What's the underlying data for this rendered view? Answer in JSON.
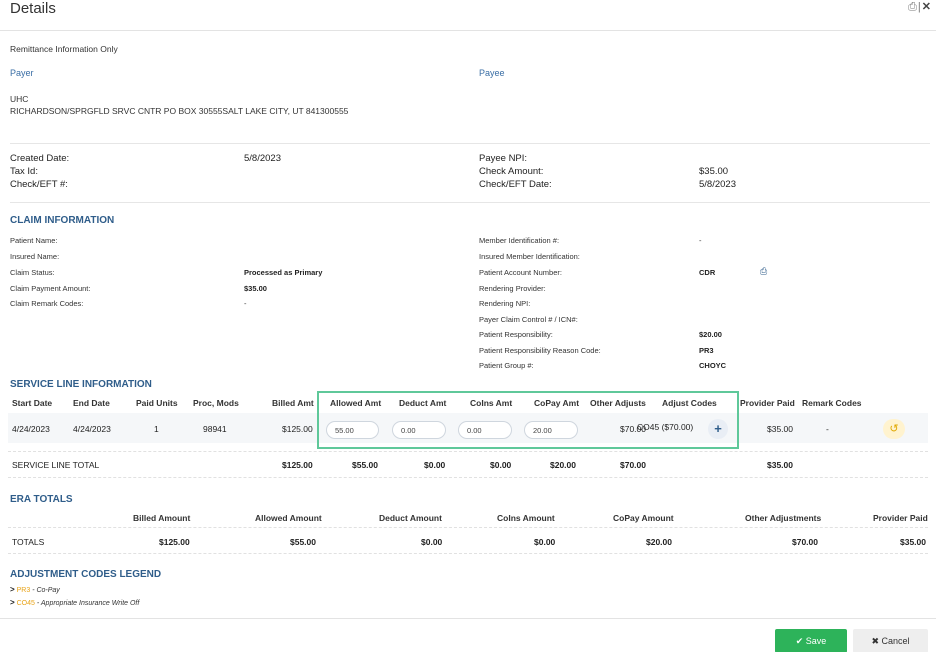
{
  "header": {
    "title": "Details",
    "window_icons": "⎙ | ✕"
  },
  "remittance_note": "Remittance Information Only",
  "payer": {
    "label": "Payer",
    "name": "UHC",
    "address": "RICHARDSON/SPRGFLD SRVC CNTR PO BOX 30555SALT LAKE CITY, UT 841300555"
  },
  "payee": {
    "label": "Payee"
  },
  "summary": {
    "created_date_label": "Created Date:",
    "created_date": "5/8/2023",
    "tax_id_label": "Tax Id:",
    "check_label": "Check/EFT #:",
    "payee_npi_label": "Payee NPI:",
    "check_amount_label": "Check Amount:",
    "check_amount": "$35.00",
    "check_date_label": "Check/EFT Date:",
    "check_date": "5/8/2023"
  },
  "claim": {
    "title": "CLAIM INFORMATION",
    "patient_name_label": "Patient Name:",
    "insured_name_label": "Insured Name:",
    "claim_status_label": "Claim Status:",
    "claim_status": "Processed as Primary",
    "payment_amount_label": "Claim Payment Amount:",
    "payment_amount": "$35.00",
    "remark_codes_label": "Claim Remark Codes:",
    "remark_codes": "-",
    "member_id_label": "Member Identification #:",
    "member_id": "-",
    "insured_member_id_label": "Insured Member Identification:",
    "patient_account_label": "Patient Account Number:",
    "patient_account": "CDR",
    "rendering_provider_label": "Rendering Provider:",
    "rendering_npi_label": "Rendering NPI:",
    "payer_claim_label": "Payer Claim Control # / ICN#:",
    "patient_resp_label": "Patient Responsibility:",
    "patient_resp": "$20.00",
    "patient_resp_reason_label": "Patient Responsibility Reason Code:",
    "patient_resp_reason": "PR3",
    "patient_group_label": "Patient Group #:",
    "patient_group": "CHOYC"
  },
  "service_line": {
    "title": "SERVICE LINE INFORMATION",
    "headers": {
      "start": "Start Date",
      "end": "End Date",
      "units": "Paid Units",
      "proc": "Proc, Mods",
      "billed": "Billed Amt",
      "allowed": "Allowed Amt",
      "deduct": "Deduct Amt",
      "coins": "CoIns Amt",
      "copay": "CoPay Amt",
      "other": "Other Adjusts",
      "adjust_codes": "Adjust Codes",
      "provider_paid": "Provider Paid",
      "remark": "Remark Codes"
    },
    "row": {
      "start": "4/24/2023",
      "end": "4/24/2023",
      "units": "1",
      "proc": "98941",
      "billed": "$125.00",
      "allowed": "55.00",
      "deduct": "0.00",
      "coins": "0.00",
      "copay": "20.00",
      "other": "$70.00",
      "adjust_codes": "CO45 ($70.00)",
      "provider_paid": "$35.00",
      "remark": "-"
    },
    "total": {
      "label": "SERVICE LINE TOTAL",
      "billed": "$125.00",
      "allowed": "$55.00",
      "deduct": "$0.00",
      "coins": "$0.00",
      "copay": "$20.00",
      "other": "$70.00",
      "provider_paid": "$35.00"
    }
  },
  "era": {
    "title": "ERA TOTALS",
    "headers": {
      "billed": "Billed Amount",
      "allowed": "Allowed Amount",
      "deduct": "Deduct Amount",
      "coins": "CoIns Amount",
      "copay": "CoPay Amount",
      "other": "Other Adjustments",
      "provider_paid": "Provider Paid"
    },
    "totals": {
      "label": "TOTALS",
      "billed": "$125.00",
      "allowed": "$55.00",
      "deduct": "$0.00",
      "coins": "$0.00",
      "copay": "$20.00",
      "other": "$70.00",
      "provider_paid": "$35.00"
    }
  },
  "legend": {
    "title": "ADJUSTMENT CODES LEGEND",
    "items": [
      {
        "code": "PR3",
        "desc": " - Co-Pay"
      },
      {
        "code": "CO45",
        "desc": " - Appropriate Insurance Write Off"
      }
    ]
  },
  "footer": {
    "save_label": "✔ Save",
    "cancel_label": "✖ Cancel"
  },
  "colors": {
    "accent_blue": "#2f5d8a",
    "highlight_green": "#5fc89a",
    "save_green": "#2db35a",
    "code_orange": "#e8a317"
  },
  "icons": {
    "print": "printer-icon",
    "close": "close-icon",
    "plus": "plus-icon",
    "undo": "undo-icon",
    "chevron": "chevron-right-icon"
  }
}
